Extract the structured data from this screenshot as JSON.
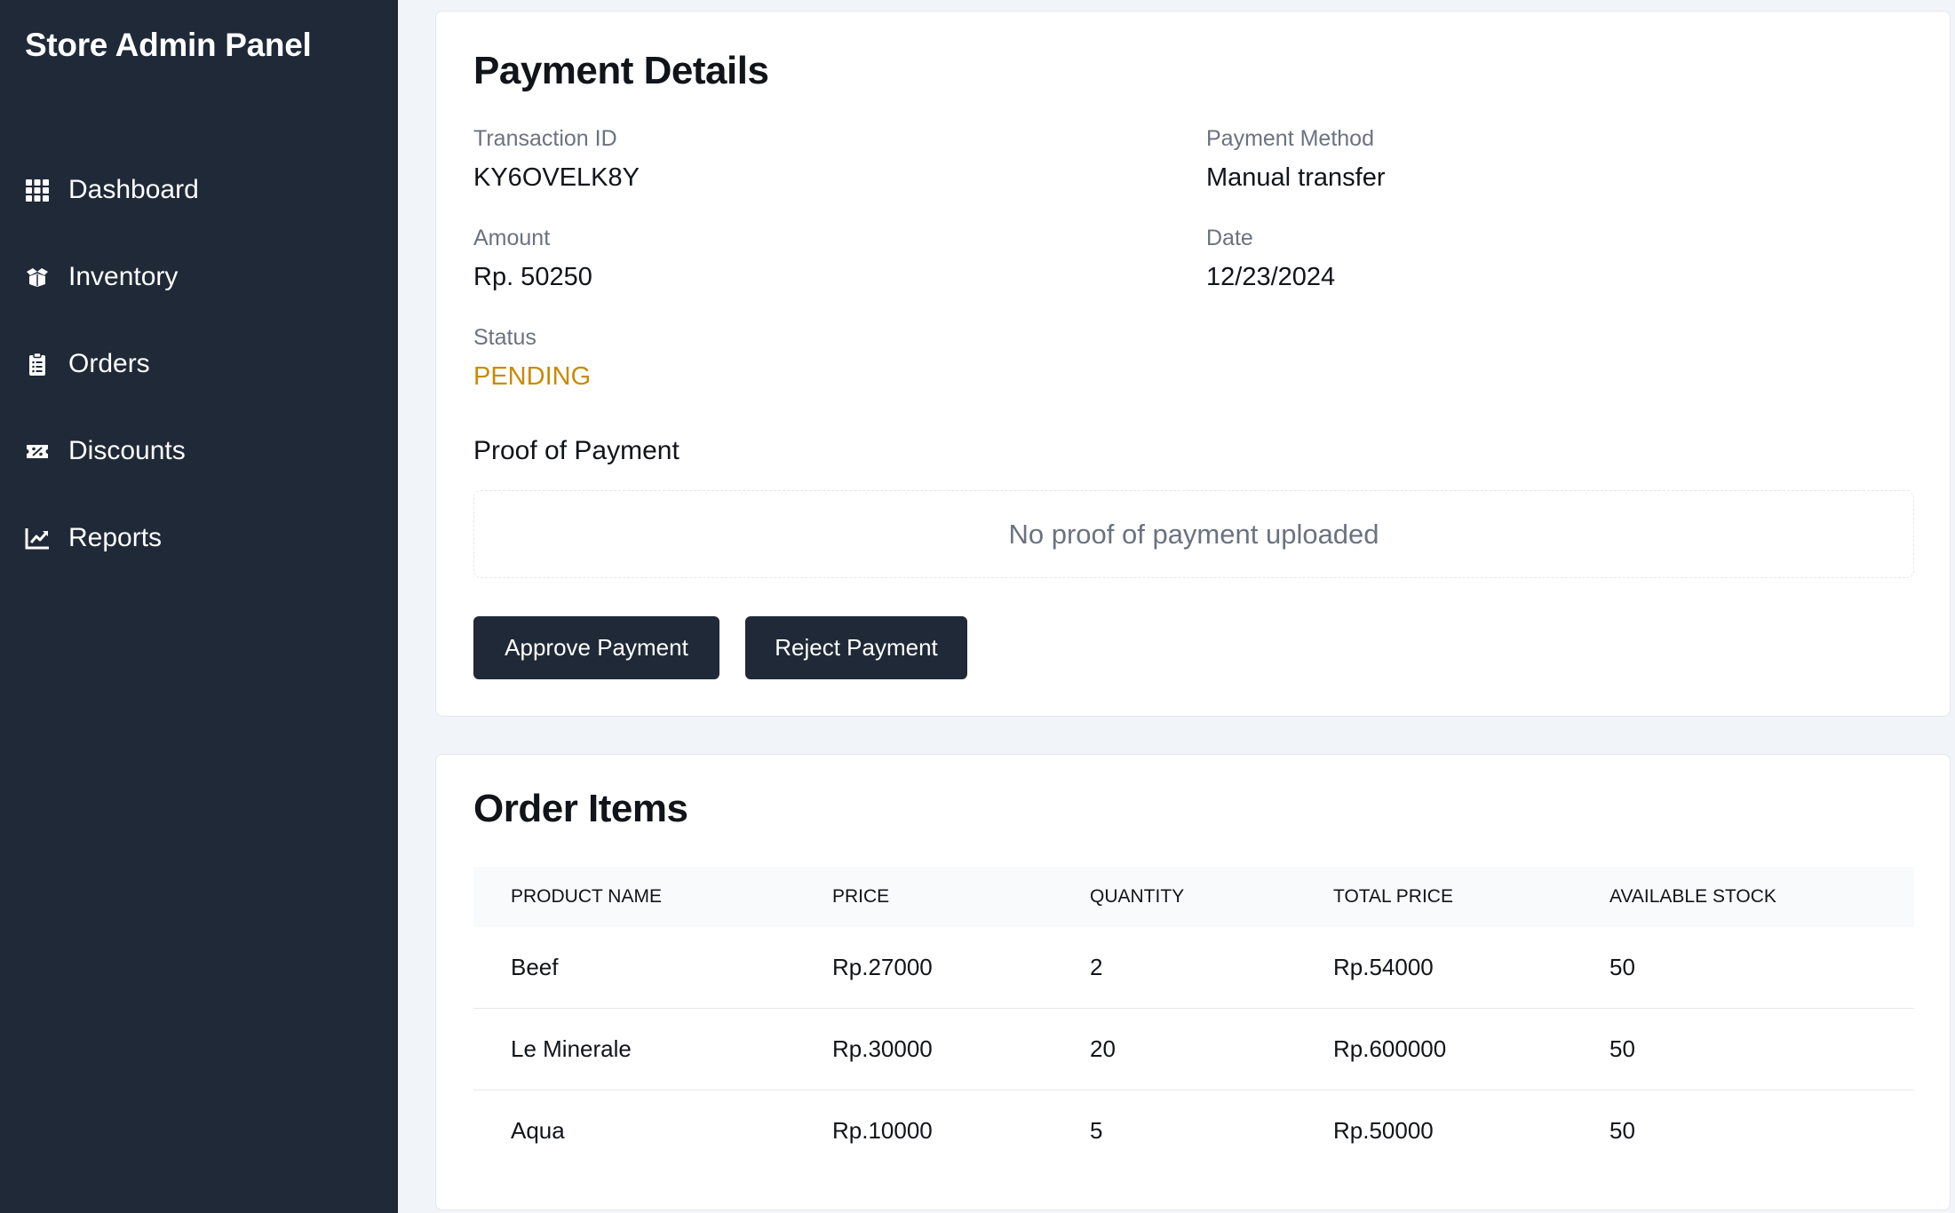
{
  "sidebar": {
    "brand": "Store Admin Panel",
    "items": [
      {
        "label": "Dashboard",
        "icon": "grid-icon"
      },
      {
        "label": "Inventory",
        "icon": "box-open-icon"
      },
      {
        "label": "Orders",
        "icon": "clipboard-list-icon"
      },
      {
        "label": "Discounts",
        "icon": "ticket-percent-icon"
      },
      {
        "label": "Reports",
        "icon": "chart-line-icon"
      }
    ],
    "background": "#1f2937"
  },
  "payment": {
    "title": "Payment Details",
    "transaction_id_label": "Transaction ID",
    "transaction_id": "KY6OVELK8Y",
    "method_label": "Payment Method",
    "method": "Manual transfer",
    "amount_label": "Amount",
    "amount": "Rp. 50250",
    "date_label": "Date",
    "date": "12/23/2024",
    "status_label": "Status",
    "status": "PENDING",
    "status_color": "#ca8a04",
    "proof_label": "Proof of Payment",
    "proof_empty": "No proof of payment uploaded",
    "approve_label": "Approve Payment",
    "reject_label": "Reject Payment"
  },
  "order_items": {
    "title": "Order Items",
    "columns": [
      "Product Name",
      "Price",
      "Quantity",
      "Total Price",
      "Available Stock"
    ],
    "rows": [
      [
        "Beef",
        "Rp.27000",
        "2",
        "Rp.54000",
        "50"
      ],
      [
        "Le Minerale",
        "Rp.30000",
        "20",
        "Rp.600000",
        "50"
      ],
      [
        "Aqua",
        "Rp.10000",
        "5",
        "Rp.50000",
        "50"
      ]
    ]
  }
}
